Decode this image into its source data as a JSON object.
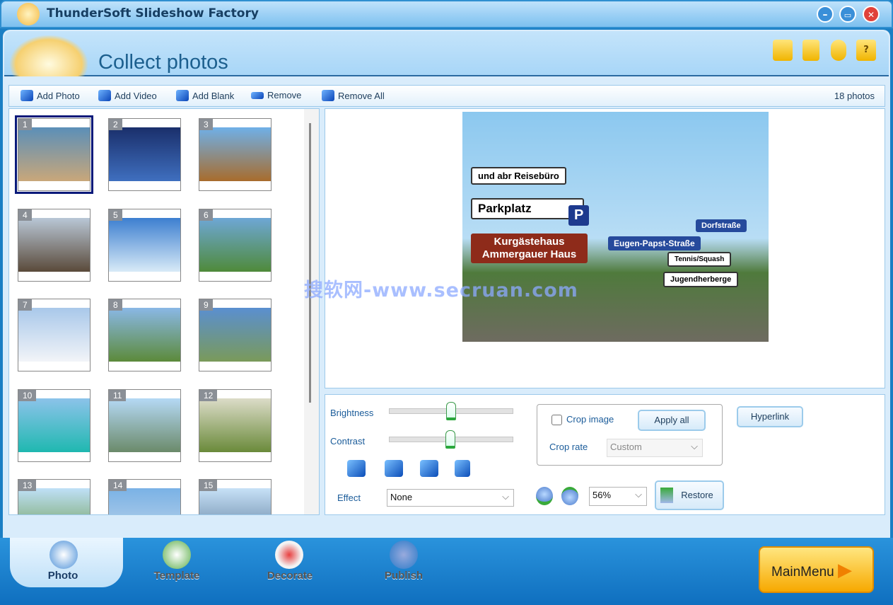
{
  "window": {
    "title": "ThunderSoft Slideshow Factory",
    "minimize": "–",
    "restore": "▭",
    "close": "✕"
  },
  "header": {
    "title": "Collect photos",
    "icons": [
      "folder-icon",
      "save-icon",
      "user-icon",
      "help-icon"
    ],
    "help_glyph": "?"
  },
  "toolbar": {
    "add_photo": "Add Photo",
    "add_video": "Add Video",
    "add_blank": "Add Blank",
    "remove": "Remove",
    "remove_all": "Remove All",
    "count": "18 photos"
  },
  "thumbnails": [
    "1",
    "2",
    "3",
    "4",
    "5",
    "6",
    "7",
    "8",
    "9",
    "10",
    "11",
    "12",
    "13",
    "14",
    "15"
  ],
  "preview": {
    "signs": [
      "und abr Reisebüro",
      "Parkplatz",
      "P",
      "Kurgästehaus Ammergauer Haus",
      "Eugen-Papst-Straße",
      "Dorfstraße",
      "Tennis/Squash",
      "Jugendherberge"
    ],
    "watermark": "搜软网-www.secruan.com"
  },
  "controls": {
    "brightness_label": "Brightness",
    "brightness_value": 0.5,
    "contrast_label": "Contrast",
    "contrast_value": 0.5,
    "effect_label": "Effect",
    "effect_value": "None",
    "crop_image_label": "Crop image",
    "crop_image_checked": false,
    "apply_all": "Apply all",
    "crop_rate_label": "Crop rate",
    "crop_rate_value": "Custom",
    "zoom_value": "56%",
    "restore": "Restore",
    "hyperlink": "Hyperlink"
  },
  "tabs": {
    "photo": "Photo",
    "template": "Template",
    "decorate": "Decorate",
    "publish": "Publish",
    "active": "Photo"
  },
  "main_menu": "MainMenu"
}
